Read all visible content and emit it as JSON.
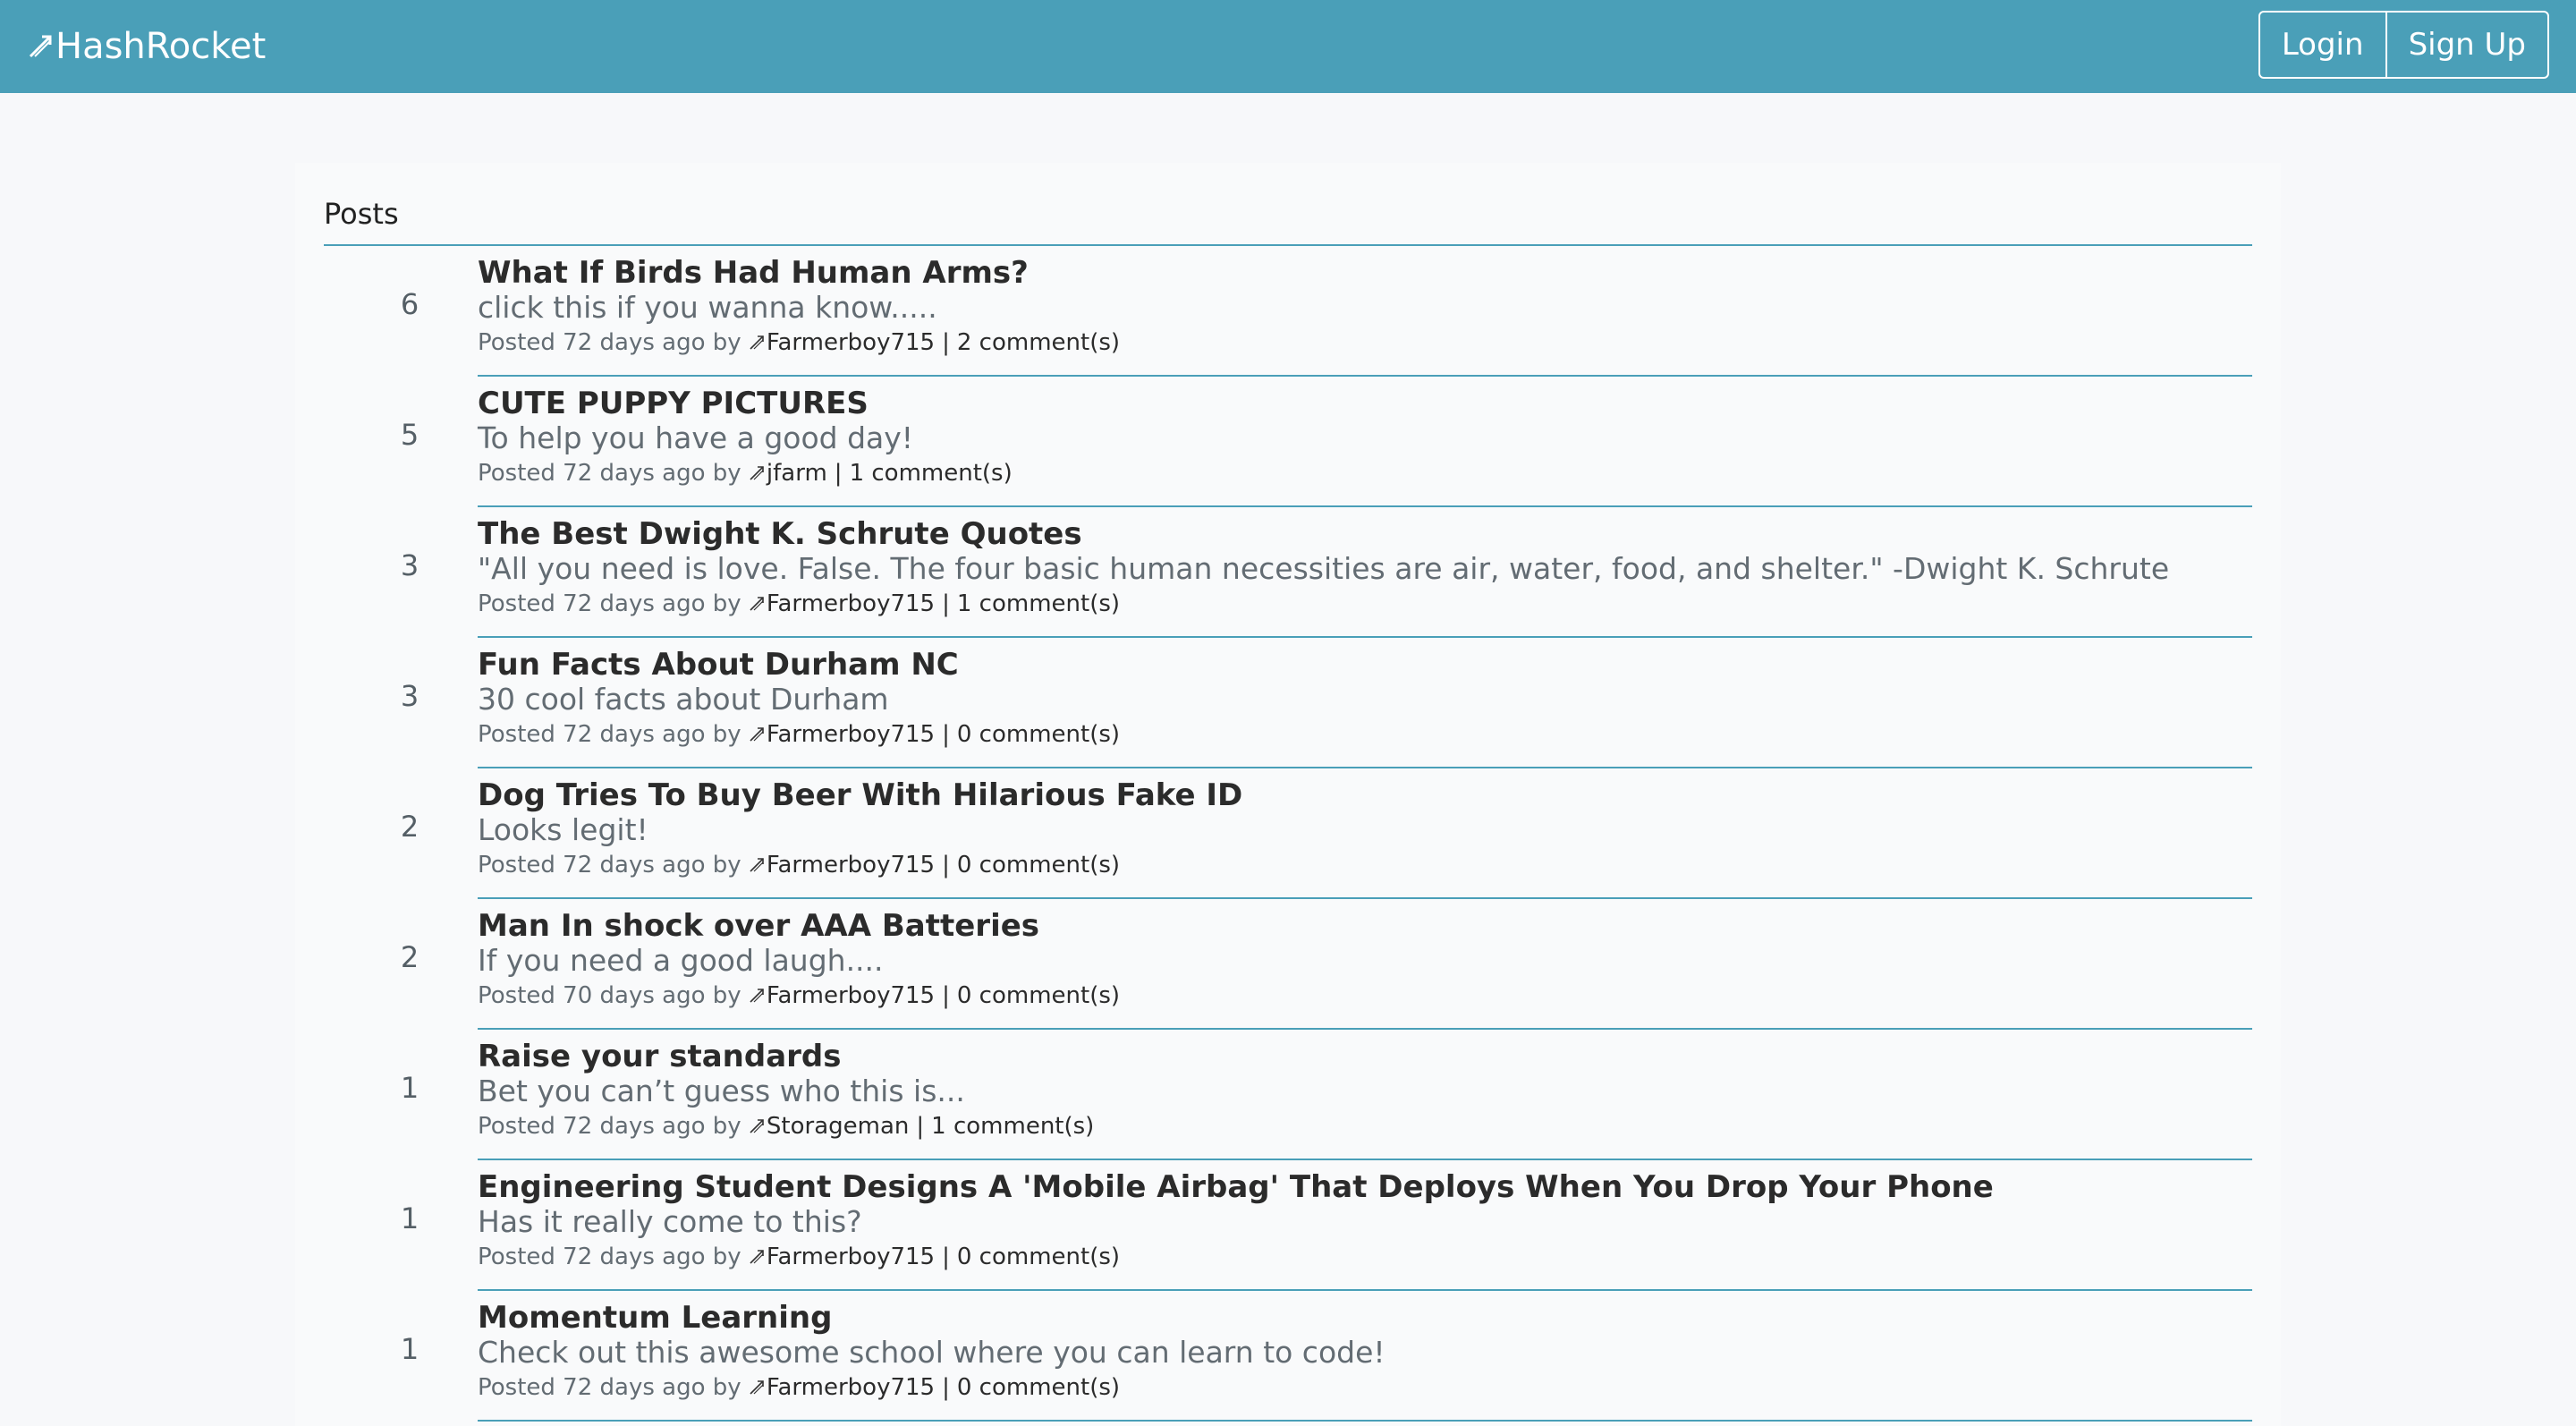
{
  "brand": {
    "name": "HashRocket"
  },
  "auth": {
    "login_label": "Login",
    "signup_label": "Sign Up"
  },
  "section": {
    "title": "Posts"
  },
  "meta_words": {
    "posted": "Posted",
    "by": "by",
    "separator": "|"
  },
  "posts": [
    {
      "score": "6",
      "title": "What If Birds Had Human Arms?",
      "description": "click this if you wanna know.....",
      "age": "72 days ago",
      "author": "Farmerboy715",
      "comments": "2 comment(s)"
    },
    {
      "score": "5",
      "title": "CUTE PUPPY PICTURES",
      "description": "To help you have a good day!",
      "age": "72 days ago",
      "author": "jfarm",
      "comments": "1 comment(s)"
    },
    {
      "score": "3",
      "title": "The Best Dwight K. Schrute Quotes",
      "description": "\"All you need is love. False. The four basic human necessities are air, water, food, and shelter.\" -Dwight K. Schrute",
      "age": "72 days ago",
      "author": "Farmerboy715",
      "comments": "1 comment(s)"
    },
    {
      "score": "3",
      "title": "Fun Facts About Durham NC",
      "description": "30 cool facts about Durham",
      "age": "72 days ago",
      "author": "Farmerboy715",
      "comments": "0 comment(s)"
    },
    {
      "score": "2",
      "title": "Dog Tries To Buy Beer With Hilarious Fake ID",
      "description": "Looks legit!",
      "age": "72 days ago",
      "author": "Farmerboy715",
      "comments": "0 comment(s)"
    },
    {
      "score": "2",
      "title": "Man In shock over AAA Batteries",
      "description": "If you need a good laugh....",
      "age": "70 days ago",
      "author": "Farmerboy715",
      "comments": "0 comment(s)"
    },
    {
      "score": "1",
      "title": "Raise your standards",
      "description": "Bet you can’t guess who this is...",
      "age": "72 days ago",
      "author": "Storageman",
      "comments": "1 comment(s)"
    },
    {
      "score": "1",
      "title": "Engineering Student Designs A 'Mobile Airbag' That Deploys When You Drop Your Phone",
      "description": "Has it really come to this?",
      "age": "72 days ago",
      "author": "Farmerboy715",
      "comments": "0 comment(s)"
    },
    {
      "score": "1",
      "title": "Momentum Learning",
      "description": "Check out this awesome school where you can learn to code!",
      "age": "72 days ago",
      "author": "Farmerboy715",
      "comments": "0 comment(s)"
    }
  ],
  "colors": {
    "accent": "#4a9fb8",
    "text": "#2b2b2b",
    "muted": "#636c73"
  },
  "icons": {
    "brand": "rocket-icon",
    "author": "rocket-icon"
  }
}
